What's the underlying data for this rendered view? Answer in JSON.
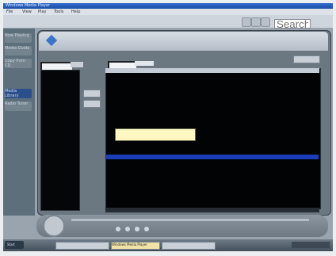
{
  "window": {
    "title": "Windows Media Player"
  },
  "menubar": {
    "items": [
      "File",
      "View",
      "Play",
      "Tools",
      "Help"
    ]
  },
  "search": {
    "placeholder": "Search"
  },
  "sidebar": {
    "items": [
      {
        "label": "Now Playing",
        "active": false
      },
      {
        "label": "Media Guide",
        "active": false
      },
      {
        "label": "Copy from CD",
        "active": false
      },
      {
        "label": "Media Library",
        "active": true
      },
      {
        "label": "Radio Tuner",
        "active": false
      }
    ]
  },
  "app": {
    "title": "",
    "subtitle": "",
    "header_note": ""
  },
  "left_pane": {
    "label": "",
    "field_value": "",
    "button_label": "",
    "buttons": [
      "",
      ""
    ]
  },
  "grid": {
    "filter_value": "",
    "filter2_value": "",
    "action_label": "",
    "columns": [
      "",
      "",
      "",
      "",
      ""
    ],
    "rows": [
      {
        "cells": [
          "",
          "",
          "",
          "",
          ""
        ],
        "selected": false
      },
      {
        "cells": [
          "",
          "",
          "",
          "",
          ""
        ],
        "selected": false
      },
      {
        "cells": [
          "",
          "",
          "",
          "",
          ""
        ],
        "selected": false
      },
      {
        "cells": [
          "",
          "",
          "",
          "",
          ""
        ],
        "selected": false
      },
      {
        "cells": [
          "",
          "",
          "",
          "",
          ""
        ],
        "selected": false
      },
      {
        "cells": [
          "",
          "",
          "",
          "",
          ""
        ],
        "selected": false
      },
      {
        "cells": [
          "",
          "",
          "",
          "",
          ""
        ],
        "selected": false
      },
      {
        "cells": [
          "",
          "",
          "",
          "",
          ""
        ],
        "selected": false
      },
      {
        "cells": [
          "",
          "",
          "",
          "",
          ""
        ],
        "selected": false
      },
      {
        "cells": [
          "",
          "",
          "",
          "",
          ""
        ],
        "selected": false
      },
      {
        "cells": [
          "",
          "",
          "",
          "",
          ""
        ],
        "selected": true
      },
      {
        "cells": [
          "",
          "",
          "",
          "",
          ""
        ],
        "selected": false
      },
      {
        "cells": [
          "",
          "",
          "",
          "",
          ""
        ],
        "selected": false
      },
      {
        "cells": [
          "",
          "",
          "",
          "",
          ""
        ],
        "selected": false
      },
      {
        "cells": [
          "",
          "",
          "",
          "",
          ""
        ],
        "selected": false
      },
      {
        "cells": [
          "",
          "",
          "",
          "",
          ""
        ],
        "selected": false
      }
    ],
    "tooltip_lines": [
      "",
      ""
    ],
    "status_text": ""
  },
  "taskbar": {
    "start_label": "Start",
    "tasks": [
      {
        "label": "",
        "active": false
      },
      {
        "label": "Windows Media Player",
        "active": true
      },
      {
        "label": "",
        "active": false
      }
    ]
  }
}
